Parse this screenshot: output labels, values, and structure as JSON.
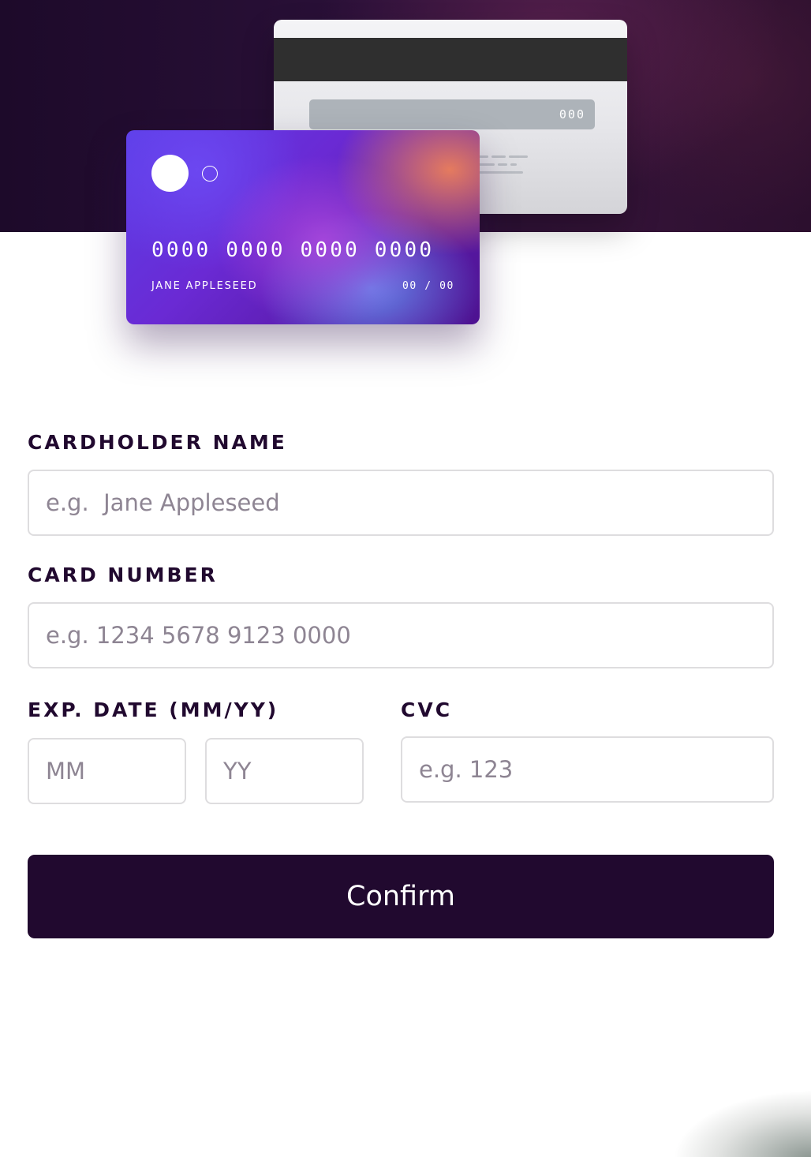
{
  "card_preview": {
    "number": "0000 0000 0000 0000",
    "holder_name": "JANE APPLESEED",
    "expiry": "00 / 00",
    "cvc": "000"
  },
  "form": {
    "cardholder_name": {
      "label": "CARDHOLDER NAME",
      "placeholder": "e.g.  Jane Appleseed",
      "value": ""
    },
    "card_number": {
      "label": "CARD NUMBER",
      "placeholder": "e.g. 1234 5678 9123 0000",
      "value": ""
    },
    "exp_date": {
      "label": "EXP. DATE  (MM/YY)",
      "month_placeholder": "MM",
      "year_placeholder": "YY"
    },
    "cvc": {
      "label": "CVC",
      "placeholder": "e.g. 123",
      "value": ""
    },
    "confirm_label": "Confirm"
  },
  "colors": {
    "hero_background": "#21092f",
    "button_background": "#21092f",
    "label_text": "#21092f",
    "placeholder_text": "#8e8593",
    "input_border": "#dedddf",
    "card_gradient_start": "#6448fe",
    "card_gradient_end": "#610595"
  }
}
